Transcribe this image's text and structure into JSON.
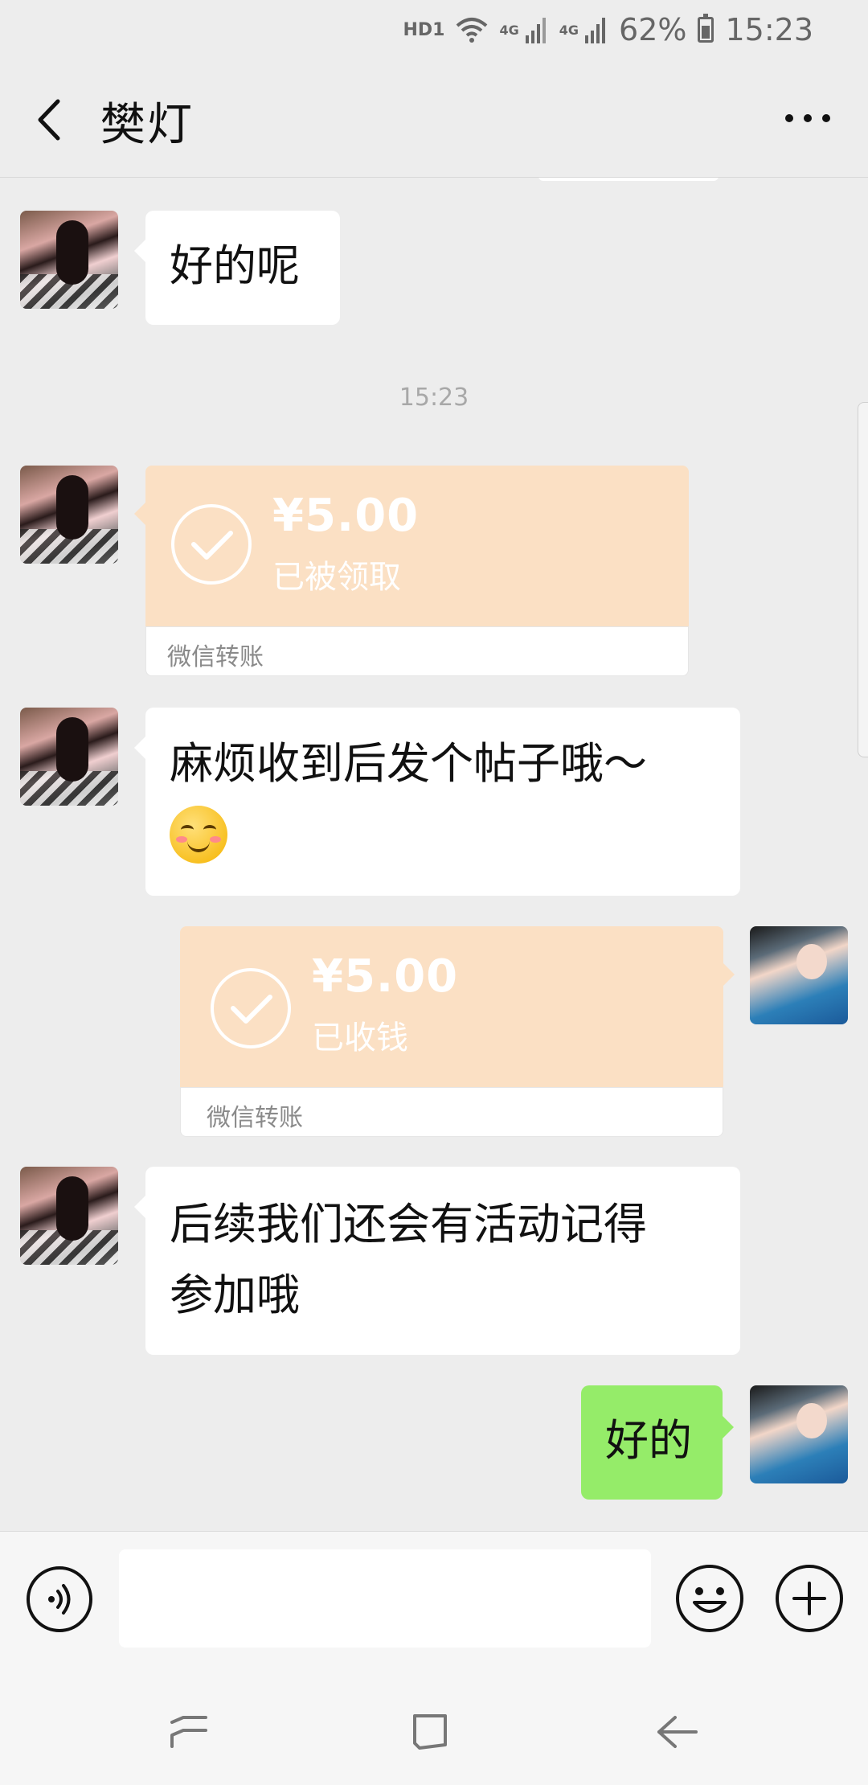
{
  "status_bar": {
    "hd_label": "HD1",
    "network_labels": [
      "4G",
      "4G"
    ],
    "battery": "62%",
    "time": "15:23"
  },
  "header": {
    "title": "樊灯",
    "back_icon": "chevron-left-icon",
    "more_icon": "more-dots-icon"
  },
  "messages": [
    {
      "type": "text",
      "side": "left",
      "text": "好的呢"
    },
    {
      "type": "timestamp",
      "text": "15:23"
    },
    {
      "type": "transfer",
      "side": "left",
      "amount": "¥5.00",
      "status": "已被领取",
      "label": "微信转账"
    },
    {
      "type": "text",
      "side": "left",
      "text": "麻烦收到后发个帖子哦～",
      "emoji": "smiling-face-with-blush-emoji"
    },
    {
      "type": "transfer",
      "side": "right",
      "amount": "¥5.00",
      "status": "已收钱",
      "label": "微信转账"
    },
    {
      "type": "text",
      "side": "left",
      "lines": [
        "后续我们还会有活动记得",
        "参加哦"
      ]
    },
    {
      "type": "text",
      "side": "right",
      "text": "好的"
    }
  ],
  "input_bar": {
    "value": "",
    "placeholder": "",
    "icons": [
      "voice-icon",
      "emoji-icon",
      "plus-icon"
    ]
  },
  "nav_bar": {
    "icons": [
      "recent-apps-icon",
      "home-icon",
      "back-arrow-icon"
    ]
  },
  "colors": {
    "background": "#ededed",
    "self_bubble": "#95ec69",
    "transfer_card": "#fbe0c4",
    "bubble": "#ffffff"
  }
}
